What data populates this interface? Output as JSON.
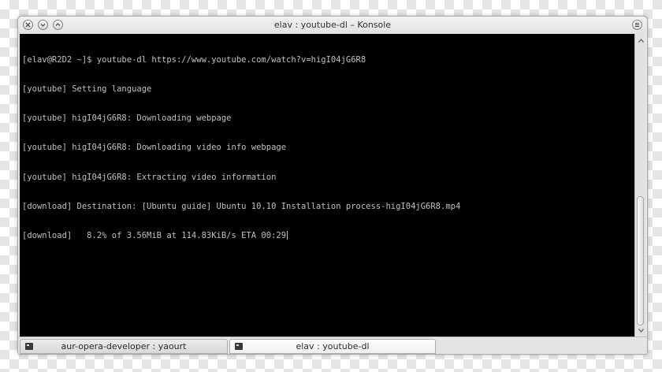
{
  "window": {
    "title": "elav : youtube-dl – Konsole",
    "buttons": [
      "close-icon",
      "minimize-icon",
      "maximize-icon",
      "menu-icon"
    ]
  },
  "terminal": {
    "lines": [
      "[elav@R2D2 ~]$ youtube-dl https://www.youtube.com/watch?v=higI04jG6R8",
      "[youtube] Setting language",
      "[youtube] higI04jG6R8: Downloading webpage",
      "[youtube] higI04jG6R8: Downloading video info webpage",
      "[youtube] higI04jG6R8: Extracting video information",
      "[download] Destination: [Ubuntu guide] Ubuntu 10.10 Installation process-higI04jG6R8.mp4",
      "[download]   8.2% of 3.56MiB at 114.83KiB/s ETA 00:29"
    ],
    "colors": {
      "background": "#000000",
      "foreground": "#c0c0c0"
    }
  },
  "tabs": [
    {
      "label": "aur-opera-developer : yaourt",
      "active": false,
      "icon": "terminal-icon"
    },
    {
      "label": "elav : youtube-dl",
      "active": true,
      "icon": "terminal-icon"
    }
  ]
}
